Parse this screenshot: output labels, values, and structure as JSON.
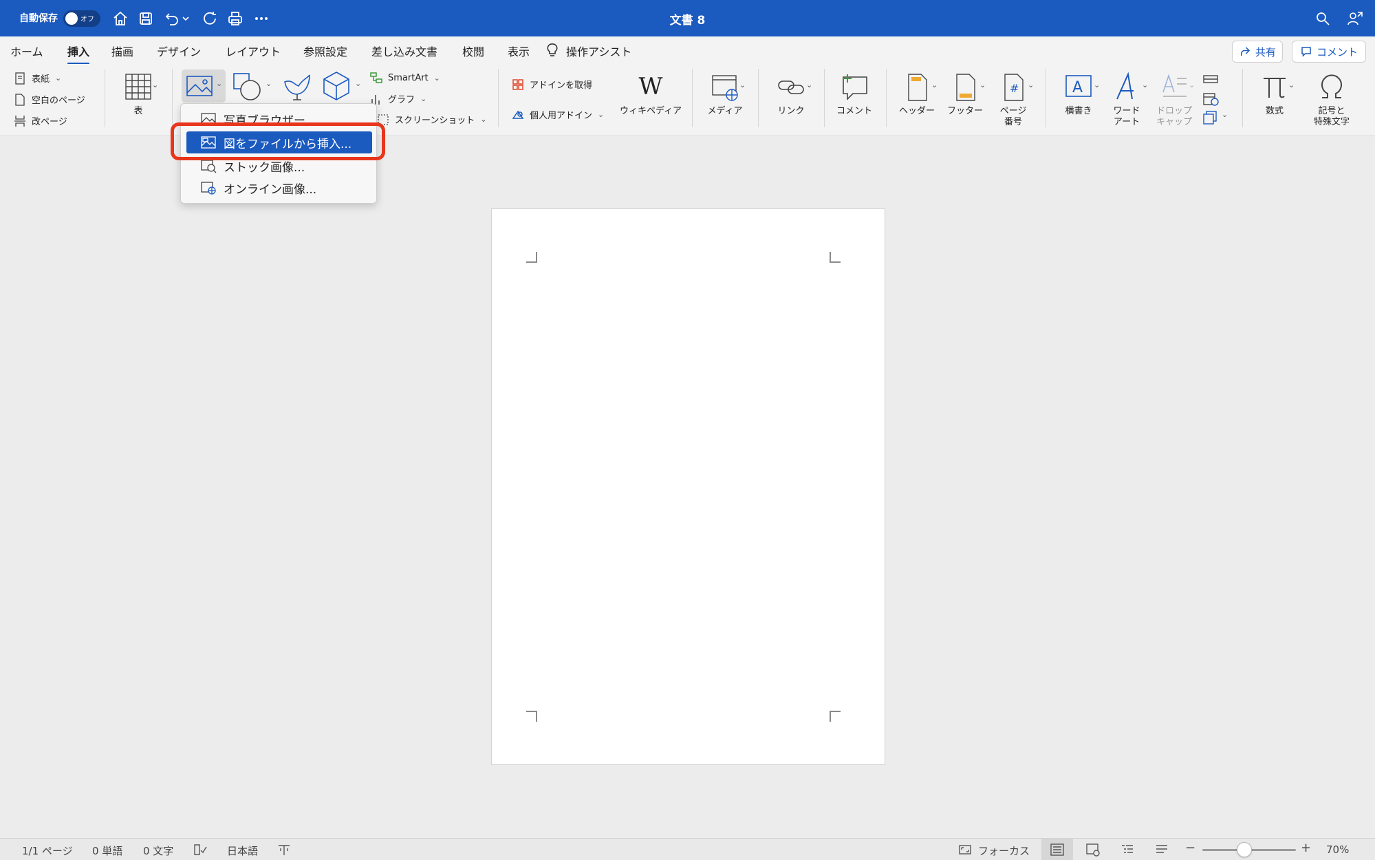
{
  "titlebar": {
    "autosave_label": "自動保存",
    "autosave_state": "オフ",
    "title": "文書 8",
    "icons": [
      "home-icon",
      "save-icon",
      "undo-icon",
      "redo-icon",
      "print-icon",
      "more-icon",
      "search-icon",
      "share-person-icon"
    ]
  },
  "tabs": [
    {
      "label": "ホーム"
    },
    {
      "label": "挿入",
      "active": true
    },
    {
      "label": "描画"
    },
    {
      "label": "デザイン"
    },
    {
      "label": "レイアウト"
    },
    {
      "label": "参照設定"
    },
    {
      "label": "差し込み文書"
    },
    {
      "label": "校閲"
    },
    {
      "label": "表示"
    },
    {
      "label": "操作アシスト"
    }
  ],
  "top_buttons": {
    "share": "共有",
    "comment": "コメント"
  },
  "ribbon": {
    "pages": {
      "cover": "表紙",
      "blank": "空白のページ",
      "page_break": "改ページ"
    },
    "table": "表",
    "smartart": "SmartArt",
    "graph": "グラフ",
    "screenshot": "スクリーンショット",
    "get_addins": "アドインを取得",
    "my_addins": "個人用アドイン",
    "wikipedia": "ウィキペディア",
    "media": "メディア",
    "link": "リンク",
    "comment": "コメント",
    "header": "ヘッダー",
    "footer": "フッター",
    "page_number": [
      "ページ",
      "番号"
    ],
    "textbox": "横書き",
    "wordart": [
      "ワード",
      "アート"
    ],
    "dropcap": [
      "ドロップ",
      "キャップ"
    ],
    "equation": "数式",
    "symbol": [
      "記号と",
      "特殊文字"
    ]
  },
  "dropdown": {
    "items": [
      {
        "label": "写真ブラウザー",
        "icon": "photo-browser-icon"
      },
      {
        "label": "図をファイルから挿入...",
        "icon": "picture-from-file-icon",
        "selected": true
      },
      {
        "label": "ストック画像...",
        "icon": "stock-images-icon"
      },
      {
        "label": "オンライン画像...",
        "icon": "online-pictures-icon"
      }
    ]
  },
  "status": {
    "page": "1/1 ページ",
    "words": "0 単語",
    "chars": "0 文字",
    "language": "日本語",
    "focus": "フォーカス",
    "zoom": "70%",
    "zoom_level": 0.45
  },
  "colors": {
    "titlebar": "#1b5abf",
    "selection": "#1b5abf",
    "highlight": "#e8351b"
  }
}
